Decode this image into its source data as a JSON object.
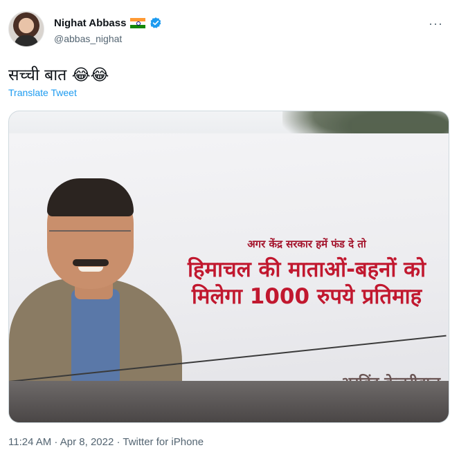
{
  "author": {
    "display_name": "Nighat Abbass",
    "handle": "@abbas_nighat",
    "flag_icon": "india-flag-icon",
    "verified_icon": "verified-badge-icon",
    "verified_color": "#1d9bf0"
  },
  "more_icon": "···",
  "tweet": {
    "text": "सच्ची बात 😂😂",
    "translate_label": "Translate Tweet"
  },
  "media": {
    "billboard_line1": "अगर केंद्र सरकार हमें फंड दे तो",
    "billboard_line2": "हिमाचल की माताओं-बहनों को",
    "billboard_line3": "मिलेगा 1000 रुपये प्रतिमाह",
    "billboard_signature": "– अरविंद केजरीवाल"
  },
  "footer": {
    "timestamp": "11:24 AM · Apr 8, 2022 · Twitter for iPhone"
  }
}
